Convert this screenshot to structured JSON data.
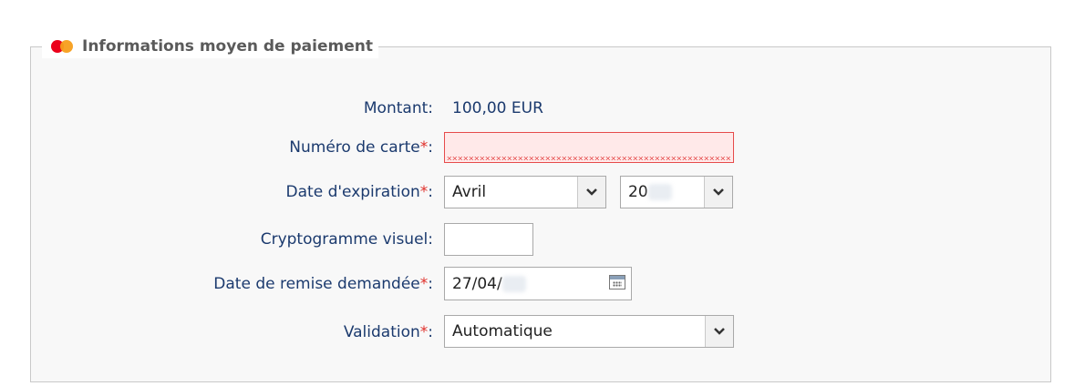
{
  "legend": {
    "title": "Informations moyen de paiement",
    "icon": "card-logo-icon",
    "colors": {
      "red": "#eb001b",
      "orange": "#f79e1b"
    }
  },
  "form": {
    "amount": {
      "label": "Montant",
      "value": "100,00 EUR"
    },
    "card_number": {
      "label": "Numéro de carte",
      "required_mark": "*",
      "value": ""
    },
    "expiry": {
      "label": "Date d'expiration",
      "required_mark": "*",
      "month": "Avril",
      "year_prefix": "20"
    },
    "cvv": {
      "label": "Cryptogramme visuel",
      "value": ""
    },
    "remit_date": {
      "label": "Date de remise demandée",
      "required_mark": "*",
      "value_prefix": "27/04/"
    },
    "validation": {
      "label": "Validation",
      "required_mark": "*",
      "value": "Automatique"
    },
    "colon": ":"
  },
  "colors": {
    "label": "#1b3a6e",
    "required": "#e0302a",
    "error_border": "#e64b4b",
    "error_bg": "#ffe9e9"
  }
}
